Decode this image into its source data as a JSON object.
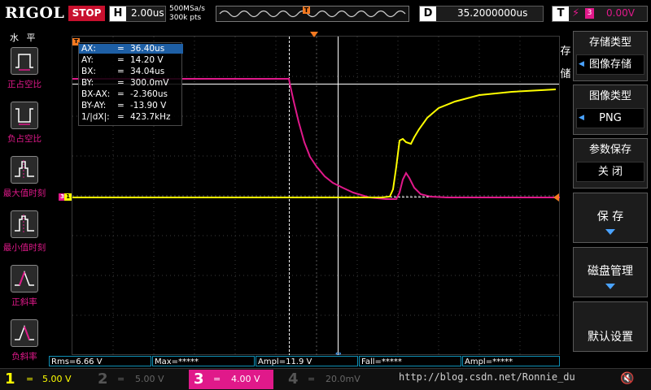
{
  "colors": {
    "ch1": "#ffff00",
    "ch3": "#e0198a",
    "cursor": "#ffffff",
    "trigger": "#f47920",
    "accent": "#1e5fa5",
    "meas_border": "#0e8fb5"
  },
  "topbar": {
    "logo": "RIGOL",
    "run_state": "STOP",
    "timebase_key": "H",
    "timebase": "2.00us",
    "sample_rate": "500MSa/s",
    "memory_depth": "300k pts",
    "delay_key": "D",
    "delay": "35.2000000us",
    "trigger_key": "T",
    "trigger_icon": "rising-edge-icon",
    "trigger_source": "3",
    "trigger_level": "0.00V"
  },
  "left_menu": {
    "title": "水 平",
    "items": [
      {
        "label": "正占空比",
        "icon": "positive-duty-icon"
      },
      {
        "label": "负占空比",
        "icon": "negative-duty-icon"
      },
      {
        "label": "最大值时刻",
        "icon": "max-time-icon"
      },
      {
        "label": "最小值时刻",
        "icon": "min-time-icon"
      },
      {
        "label": "正斜率",
        "icon": "positive-slope-icon"
      },
      {
        "label": "负斜率",
        "icon": "negative-slope-icon"
      }
    ]
  },
  "cursor": {
    "rows": [
      {
        "name": "AX:",
        "eq": "=",
        "value": "36.40us"
      },
      {
        "name": "AY:",
        "eq": "=",
        "value": "14.20 V"
      },
      {
        "name": "BX:",
        "eq": "=",
        "value": "34.04us"
      },
      {
        "name": "BY:",
        "eq": "=",
        "value": "300.0mV"
      },
      {
        "name": "BX-AX:",
        "eq": "=",
        "value": "-2.360us"
      },
      {
        "name": "BY-AY:",
        "eq": "=",
        "value": "-13.90 V"
      },
      {
        "name": "1/|dX|:",
        "eq": "=",
        "value": "423.7kHz"
      }
    ]
  },
  "right_menu": {
    "side_label": [
      "存",
      "储"
    ],
    "storage_type_label": "存储类型",
    "storage_type_value": "图像存储",
    "image_type_label": "图像类型",
    "image_type_value": "PNG",
    "param_save_label": "参数保存",
    "param_save_value": "关 闭",
    "save_label": "保 存",
    "disk_label": "磁盘管理",
    "default_label": "默认设置"
  },
  "measurements": {
    "items": [
      "Rms=6.66 V",
      "Max=*****",
      "Ampl=11.9 V",
      "Fall=*****",
      "Ampl=*****"
    ]
  },
  "channels": [
    {
      "num": "1",
      "coupling": "=",
      "scale": "5.00 V",
      "state": "on"
    },
    {
      "num": "2",
      "coupling": "=",
      "scale": "5.00 V",
      "state": "off"
    },
    {
      "num": "3",
      "coupling": "=",
      "scale": "4.00 V",
      "state": "active"
    },
    {
      "num": "4",
      "coupling": "=",
      "scale": "20.0mV",
      "state": "off"
    }
  ],
  "watermark": "http://blog.csdn.net/Ronnie_du"
}
